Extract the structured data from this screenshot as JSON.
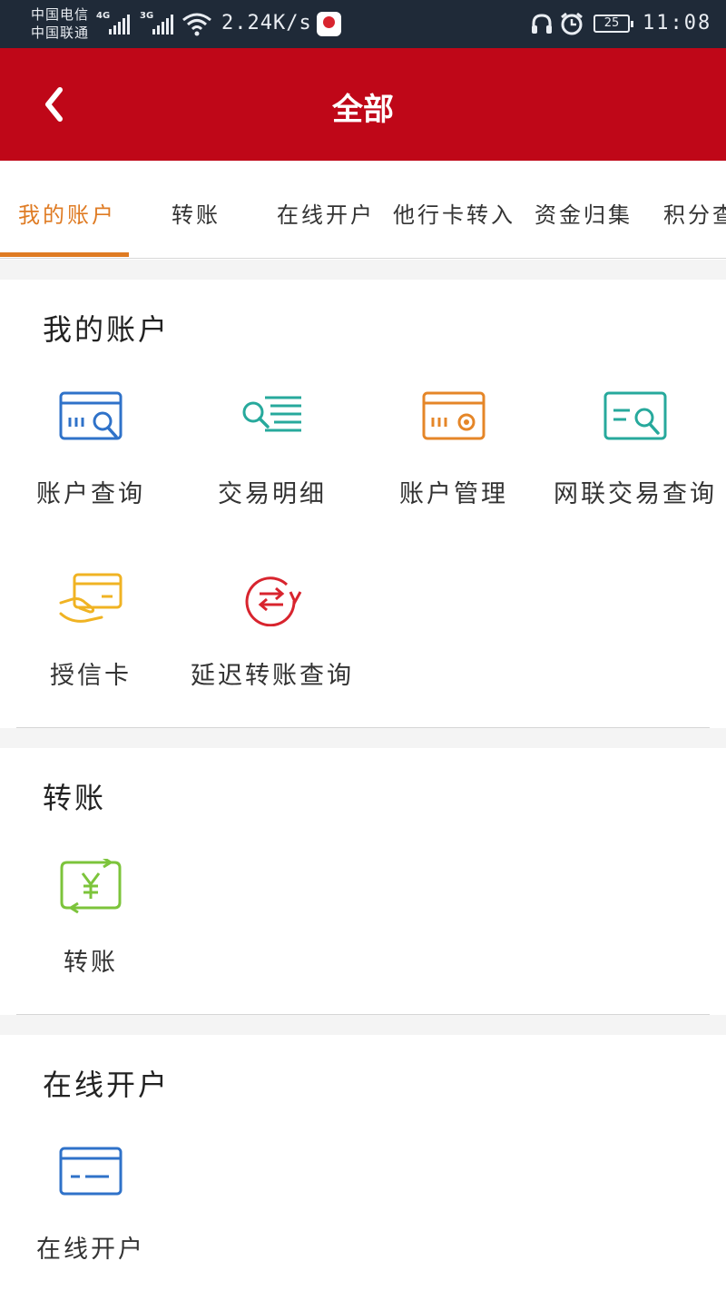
{
  "status_bar": {
    "carrier1": "中国电信",
    "carrier2": "中国联通",
    "net1": "4G",
    "net2": "3G",
    "speed": "2.24K/s",
    "battery": "25",
    "time": "11:08"
  },
  "header": {
    "title": "全部"
  },
  "tabs": [
    {
      "label": "我的账户"
    },
    {
      "label": "转账"
    },
    {
      "label": "在线开户"
    },
    {
      "label": "他行卡转入"
    },
    {
      "label": "资金归集"
    },
    {
      "label": "积分查"
    }
  ],
  "sections": [
    {
      "title": "我的账户",
      "items": [
        {
          "label": "账户查询",
          "icon": "card-search-icon",
          "color": "#2f72c9"
        },
        {
          "label": "交易明细",
          "icon": "list-search-icon",
          "color": "#27a99c"
        },
        {
          "label": "账户管理",
          "icon": "card-gear-icon",
          "color": "#e58628"
        },
        {
          "label": "网联交易查询",
          "icon": "doc-search-icon",
          "color": "#27a99c"
        },
        {
          "label": "授信卡",
          "icon": "hand-card-icon",
          "color": "#f0b323"
        },
        {
          "label": "延迟转账查询",
          "icon": "delay-transfer-icon",
          "color": "#d8242e"
        }
      ]
    },
    {
      "title": "转账",
      "items": [
        {
          "label": "转账",
          "icon": "yuan-transfer-icon",
          "color": "#7cc43b"
        }
      ]
    },
    {
      "title": "在线开户",
      "items": [
        {
          "label": "在线开户",
          "icon": "card-open-icon",
          "color": "#2f72c9"
        }
      ]
    }
  ]
}
